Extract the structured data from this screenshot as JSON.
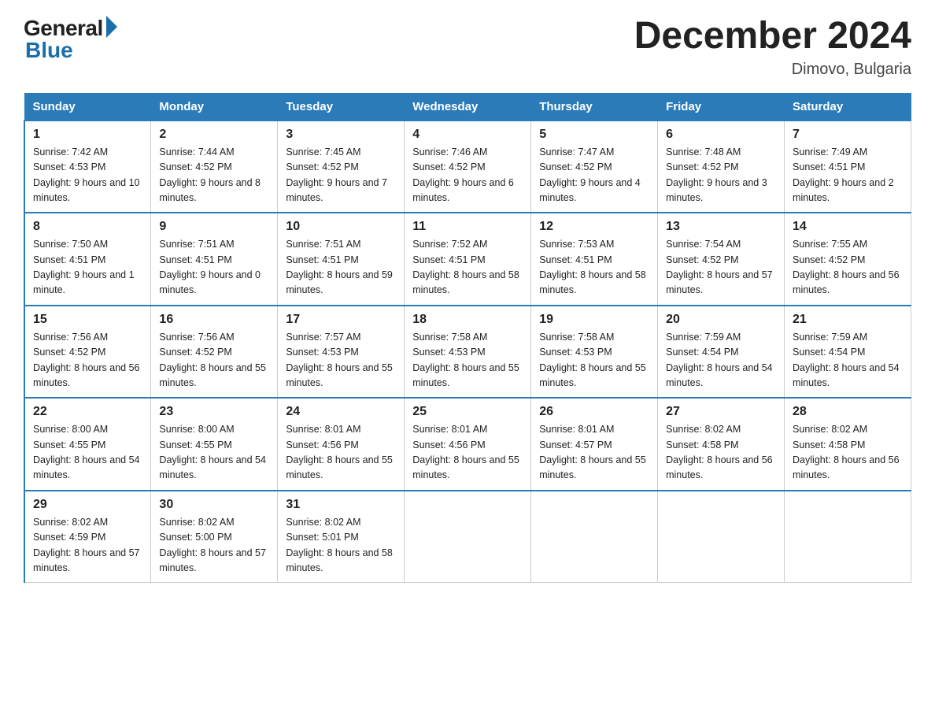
{
  "header": {
    "logo_general": "General",
    "logo_blue": "Blue",
    "title": "December 2024",
    "subtitle": "Dimovo, Bulgaria"
  },
  "weekdays": [
    "Sunday",
    "Monday",
    "Tuesday",
    "Wednesday",
    "Thursday",
    "Friday",
    "Saturday"
  ],
  "weeks": [
    [
      {
        "day": "1",
        "sunrise": "7:42 AM",
        "sunset": "4:53 PM",
        "daylight": "9 hours and 10 minutes."
      },
      {
        "day": "2",
        "sunrise": "7:44 AM",
        "sunset": "4:52 PM",
        "daylight": "9 hours and 8 minutes."
      },
      {
        "day": "3",
        "sunrise": "7:45 AM",
        "sunset": "4:52 PM",
        "daylight": "9 hours and 7 minutes."
      },
      {
        "day": "4",
        "sunrise": "7:46 AM",
        "sunset": "4:52 PM",
        "daylight": "9 hours and 6 minutes."
      },
      {
        "day": "5",
        "sunrise": "7:47 AM",
        "sunset": "4:52 PM",
        "daylight": "9 hours and 4 minutes."
      },
      {
        "day": "6",
        "sunrise": "7:48 AM",
        "sunset": "4:52 PM",
        "daylight": "9 hours and 3 minutes."
      },
      {
        "day": "7",
        "sunrise": "7:49 AM",
        "sunset": "4:51 PM",
        "daylight": "9 hours and 2 minutes."
      }
    ],
    [
      {
        "day": "8",
        "sunrise": "7:50 AM",
        "sunset": "4:51 PM",
        "daylight": "9 hours and 1 minute."
      },
      {
        "day": "9",
        "sunrise": "7:51 AM",
        "sunset": "4:51 PM",
        "daylight": "9 hours and 0 minutes."
      },
      {
        "day": "10",
        "sunrise": "7:51 AM",
        "sunset": "4:51 PM",
        "daylight": "8 hours and 59 minutes."
      },
      {
        "day": "11",
        "sunrise": "7:52 AM",
        "sunset": "4:51 PM",
        "daylight": "8 hours and 58 minutes."
      },
      {
        "day": "12",
        "sunrise": "7:53 AM",
        "sunset": "4:51 PM",
        "daylight": "8 hours and 58 minutes."
      },
      {
        "day": "13",
        "sunrise": "7:54 AM",
        "sunset": "4:52 PM",
        "daylight": "8 hours and 57 minutes."
      },
      {
        "day": "14",
        "sunrise": "7:55 AM",
        "sunset": "4:52 PM",
        "daylight": "8 hours and 56 minutes."
      }
    ],
    [
      {
        "day": "15",
        "sunrise": "7:56 AM",
        "sunset": "4:52 PM",
        "daylight": "8 hours and 56 minutes."
      },
      {
        "day": "16",
        "sunrise": "7:56 AM",
        "sunset": "4:52 PM",
        "daylight": "8 hours and 55 minutes."
      },
      {
        "day": "17",
        "sunrise": "7:57 AM",
        "sunset": "4:53 PM",
        "daylight": "8 hours and 55 minutes."
      },
      {
        "day": "18",
        "sunrise": "7:58 AM",
        "sunset": "4:53 PM",
        "daylight": "8 hours and 55 minutes."
      },
      {
        "day": "19",
        "sunrise": "7:58 AM",
        "sunset": "4:53 PM",
        "daylight": "8 hours and 55 minutes."
      },
      {
        "day": "20",
        "sunrise": "7:59 AM",
        "sunset": "4:54 PM",
        "daylight": "8 hours and 54 minutes."
      },
      {
        "day": "21",
        "sunrise": "7:59 AM",
        "sunset": "4:54 PM",
        "daylight": "8 hours and 54 minutes."
      }
    ],
    [
      {
        "day": "22",
        "sunrise": "8:00 AM",
        "sunset": "4:55 PM",
        "daylight": "8 hours and 54 minutes."
      },
      {
        "day": "23",
        "sunrise": "8:00 AM",
        "sunset": "4:55 PM",
        "daylight": "8 hours and 54 minutes."
      },
      {
        "day": "24",
        "sunrise": "8:01 AM",
        "sunset": "4:56 PM",
        "daylight": "8 hours and 55 minutes."
      },
      {
        "day": "25",
        "sunrise": "8:01 AM",
        "sunset": "4:56 PM",
        "daylight": "8 hours and 55 minutes."
      },
      {
        "day": "26",
        "sunrise": "8:01 AM",
        "sunset": "4:57 PM",
        "daylight": "8 hours and 55 minutes."
      },
      {
        "day": "27",
        "sunrise": "8:02 AM",
        "sunset": "4:58 PM",
        "daylight": "8 hours and 56 minutes."
      },
      {
        "day": "28",
        "sunrise": "8:02 AM",
        "sunset": "4:58 PM",
        "daylight": "8 hours and 56 minutes."
      }
    ],
    [
      {
        "day": "29",
        "sunrise": "8:02 AM",
        "sunset": "4:59 PM",
        "daylight": "8 hours and 57 minutes."
      },
      {
        "day": "30",
        "sunrise": "8:02 AM",
        "sunset": "5:00 PM",
        "daylight": "8 hours and 57 minutes."
      },
      {
        "day": "31",
        "sunrise": "8:02 AM",
        "sunset": "5:01 PM",
        "daylight": "8 hours and 58 minutes."
      },
      null,
      null,
      null,
      null
    ]
  ]
}
